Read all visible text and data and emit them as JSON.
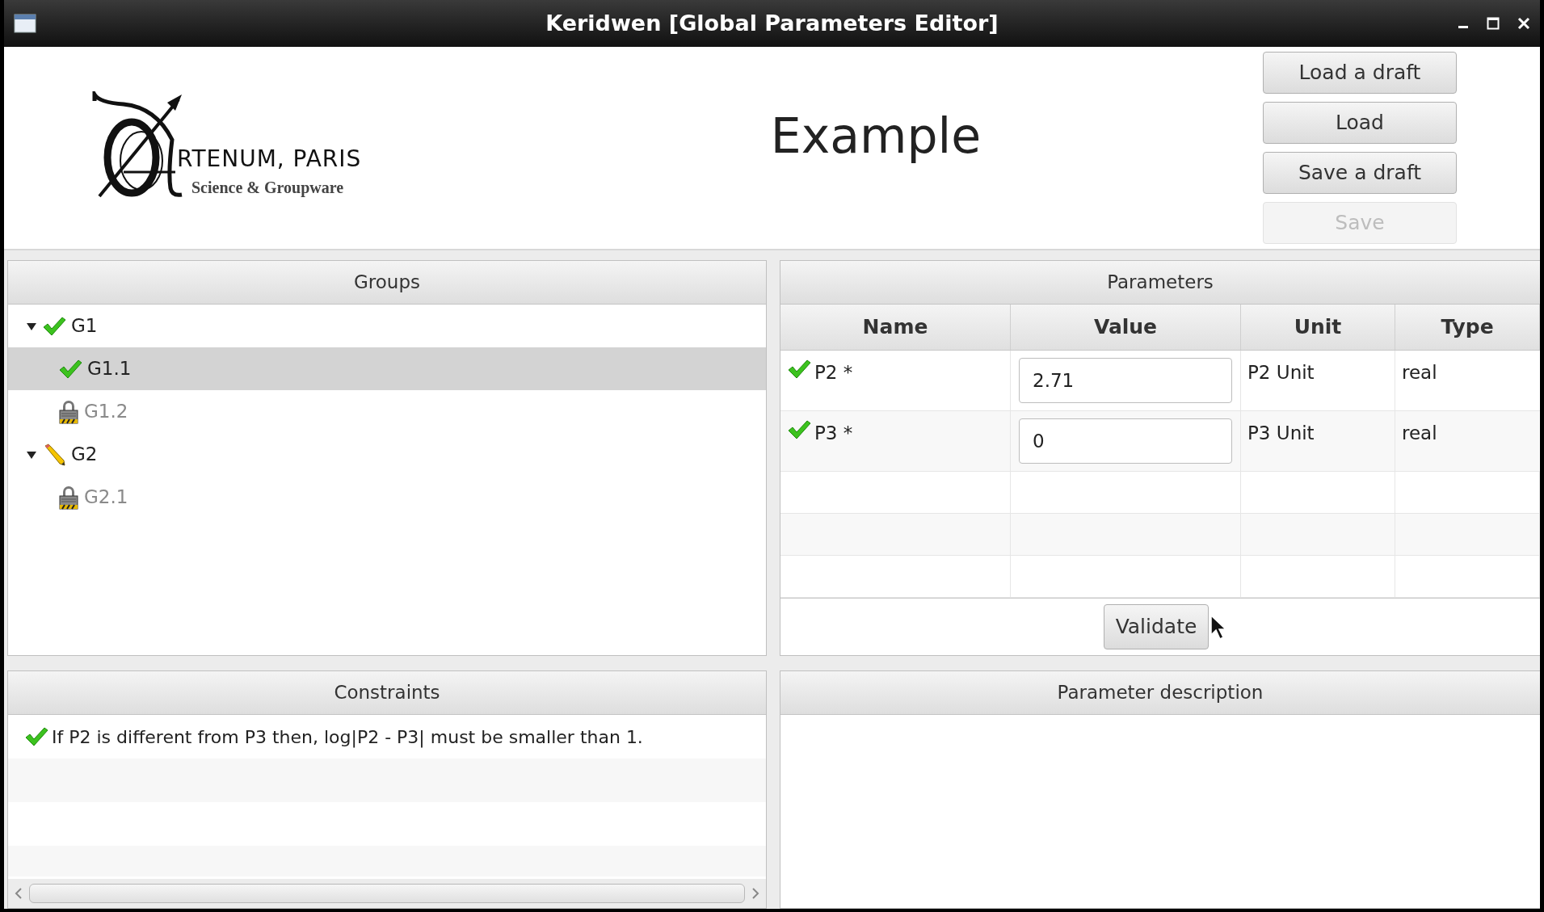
{
  "window": {
    "title": "Keridwen [Global Parameters Editor]"
  },
  "header": {
    "logo": {
      "name": "RTENUM, PARIS",
      "tagline": "Science & Groupware"
    },
    "title": "Example",
    "buttons": [
      {
        "label": "Load a draft",
        "disabled": false
      },
      {
        "label": "Load",
        "disabled": false
      },
      {
        "label": "Save a draft",
        "disabled": false
      },
      {
        "label": "Save",
        "disabled": true
      }
    ]
  },
  "groups": {
    "title": "Groups",
    "tree": [
      {
        "label": "G1",
        "kind": "valid",
        "expanded": true,
        "selected": false,
        "disabled": false,
        "children": [
          {
            "label": "G1.1",
            "kind": "valid",
            "selected": true,
            "disabled": false
          },
          {
            "label": "G1.2",
            "kind": "locked",
            "selected": false,
            "disabled": true
          }
        ]
      },
      {
        "label": "G2",
        "kind": "editing",
        "expanded": true,
        "selected": false,
        "disabled": false,
        "children": [
          {
            "label": "G2.1",
            "kind": "locked",
            "selected": false,
            "disabled": true
          }
        ]
      }
    ]
  },
  "parameters": {
    "title": "Parameters",
    "columns": [
      "Name",
      "Value",
      "Unit",
      "Type"
    ],
    "rows": [
      {
        "name": "P2 *",
        "valid": true,
        "value": "2.71",
        "unit": "P2 Unit",
        "type": "real"
      },
      {
        "name": "P3 *",
        "valid": true,
        "value": "0",
        "unit": "P3 Unit",
        "type": "real"
      }
    ],
    "validate_button": "Validate"
  },
  "constraints": {
    "title": "Constraints",
    "items": [
      {
        "text": "If P2 is different from P3 then, log|P2 - P3| must be smaller than 1.",
        "valid": true
      }
    ]
  },
  "description": {
    "title": "Parameter description"
  }
}
